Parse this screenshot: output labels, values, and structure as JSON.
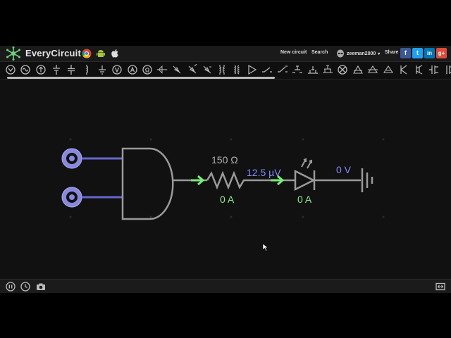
{
  "header": {
    "brand": "EveryCircuit",
    "new_circuit": "New circuit",
    "search": "Search",
    "username": "zeeman2000",
    "share": "Share"
  },
  "platforms": [
    "chrome-icon",
    "android-icon",
    "apple-icon"
  ],
  "social": [
    {
      "name": "facebook",
      "glyph": "f",
      "color": "#3b5998"
    },
    {
      "name": "twitter",
      "glyph": "t",
      "color": "#1da1f2"
    },
    {
      "name": "linkedin",
      "glyph": "in",
      "color": "#0077b5"
    },
    {
      "name": "googleplus",
      "glyph": "g+",
      "color": "#dd4b39"
    }
  ],
  "circuit": {
    "resistor_value": "150 Ω",
    "node_voltage": "12.5 µV",
    "resistor_current": "0 A",
    "led_current": "0 A",
    "ground_voltage": "0 V"
  },
  "colors": {
    "wire": "#9a9a9a",
    "input_wire": "#6666cc",
    "label_value": "#b0b0b0",
    "voltage": "#8888ff",
    "current": "#88ee88",
    "arrow": "#77ee77"
  }
}
